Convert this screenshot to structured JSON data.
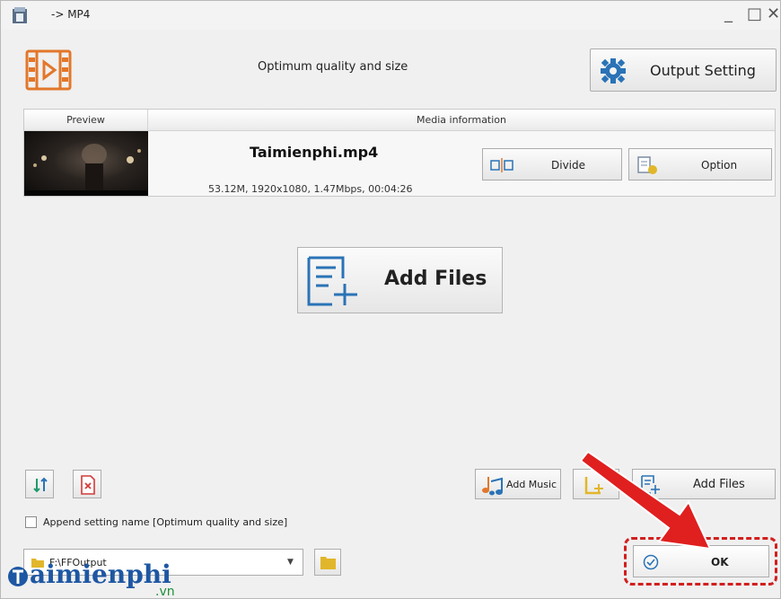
{
  "window": {
    "title": "-> MP4"
  },
  "header": {
    "quality_label": "Optimum quality and size",
    "output_setting_label": "Output Setting"
  },
  "media_table": {
    "columns": [
      "Preview",
      "Media information"
    ],
    "items": [
      {
        "file_name": "Taimienphi.mp4",
        "info": "53.12M, 1920x1080, 1.47Mbps, 00:04:26",
        "divide_label": "Divide",
        "option_label": "Option"
      }
    ]
  },
  "center": {
    "add_files_label": "Add Files"
  },
  "toolbar": {
    "add_music_label": "Add Music",
    "add_files_label": "Add Files"
  },
  "options": {
    "append_setting_label": "Append setting name [Optimum quality and size]"
  },
  "output": {
    "path": "F:\\FFOutput"
  },
  "footer": {
    "ok_label": "OK"
  },
  "watermark": {
    "brand": "aimienphi",
    "suffix": ".vn"
  },
  "colors": {
    "accent_orange": "#e2772a",
    "accent_blue": "#2a73b6",
    "highlight_red": "#d21e1e"
  }
}
